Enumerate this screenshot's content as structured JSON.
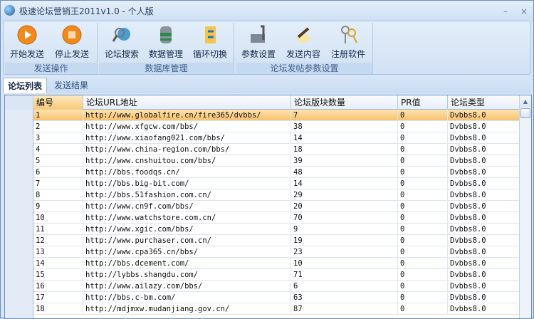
{
  "title": "极速论坛营销王2011v1.0 - 个人版",
  "window_controls": {
    "minimize": "–",
    "close": "×"
  },
  "ribbon": {
    "groups": [
      {
        "label": "发送操作",
        "buttons": [
          {
            "label": "开始发送",
            "icon": "play-icon"
          },
          {
            "label": "停止发送",
            "icon": "stop-icon"
          }
        ]
      },
      {
        "label": "数据库管理",
        "buttons": [
          {
            "label": "论坛搜索",
            "icon": "search-globe-icon"
          },
          {
            "label": "数据管理",
            "icon": "database-icon"
          },
          {
            "label": "循环切换",
            "icon": "folder-cycle-icon"
          }
        ]
      },
      {
        "label": "论坛发帖参数设置",
        "buttons": [
          {
            "label": "参数设置",
            "icon": "tools-icon"
          },
          {
            "label": "发送内容",
            "icon": "pen-paper-icon"
          },
          {
            "label": "注册软件",
            "icon": "keys-icon"
          }
        ]
      }
    ]
  },
  "tabs": [
    {
      "label": "论坛列表",
      "active": true
    },
    {
      "label": "发送结果",
      "active": false
    }
  ],
  "table": {
    "columns": [
      "编号",
      "论坛URL地址",
      "论坛版块数量",
      "PR值",
      "论坛类型"
    ],
    "selected_row": 1,
    "rows": [
      [
        "1",
        "http://www.globalfire.cn/fire365/dvbbs/",
        "7",
        "0",
        "Dvbbs8.0"
      ],
      [
        "2",
        "http://www.xfgcw.com/bbs/",
        "38",
        "0",
        "Dvbbs8.0"
      ],
      [
        "3",
        "http://www.xiaofang021.com/bbs/",
        "14",
        "0",
        "Dvbbs8.0"
      ],
      [
        "4",
        "http://www.china-region.com/bbs/",
        "18",
        "0",
        "Dvbbs8.0"
      ],
      [
        "5",
        "http://www.cnshuitou.com/bbs/",
        "39",
        "0",
        "Dvbbs8.0"
      ],
      [
        "6",
        "http://bbs.foodqs.cn/",
        "48",
        "0",
        "Dvbbs8.0"
      ],
      [
        "7",
        "http://bbs.big-bit.com/",
        "14",
        "0",
        "Dvbbs8.0"
      ],
      [
        "8",
        "http://bbs.51fashion.com.cn/",
        "29",
        "0",
        "Dvbbs8.0"
      ],
      [
        "9",
        "http://www.cn9f.com/bbs/",
        "20",
        "0",
        "Dvbbs8.0"
      ],
      [
        "10",
        "http://www.watchstore.com.cn/",
        "70",
        "0",
        "Dvbbs8.0"
      ],
      [
        "11",
        "http://www.xgic.com/bbs/",
        "9",
        "0",
        "Dvbbs8.0"
      ],
      [
        "12",
        "http://www.purchaser.com.cn/",
        "19",
        "0",
        "Dvbbs8.0"
      ],
      [
        "13",
        "http://www.cpa365.cn/bbs/",
        "23",
        "0",
        "Dvbbs8.0"
      ],
      [
        "14",
        "http://bbs.dcement.com/",
        "10",
        "0",
        "Dvbbs8.0"
      ],
      [
        "15",
        "http://lybbs.shangdu.com/",
        "71",
        "0",
        "Dvbbs8.0"
      ],
      [
        "16",
        "http://www.ailazy.com/bbs/",
        "6",
        "0",
        "Dvbbs8.0"
      ],
      [
        "17",
        "http://bbs.c-bm.com/",
        "63",
        "0",
        "Dvbbs8.0"
      ],
      [
        "18",
        "http://mdjmxw.mudanjiang.gov.cn/",
        "87",
        "0",
        "Dvbbs8.0"
      ]
    ]
  }
}
